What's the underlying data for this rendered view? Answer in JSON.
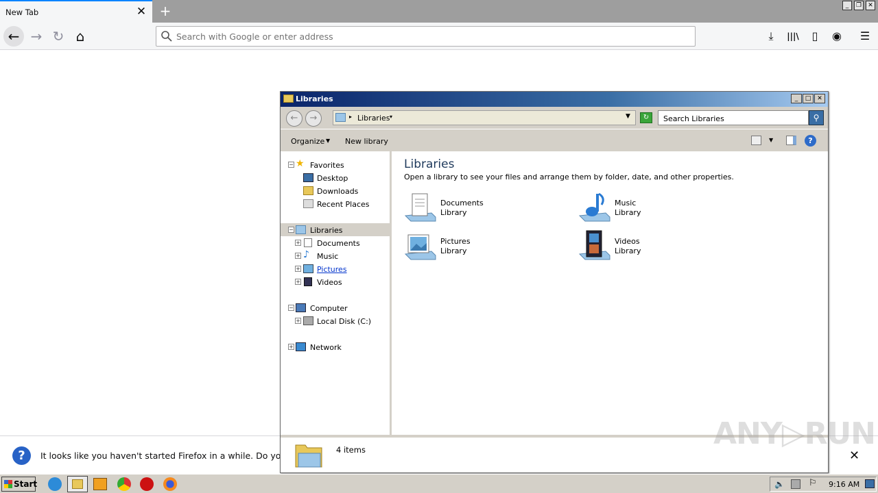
{
  "firefox": {
    "tab_title": "New Tab",
    "tab_close": "✕",
    "new_tab": "+",
    "win_buttons": [
      "_",
      "❐",
      "✕"
    ],
    "nav": {
      "back": "←",
      "forward": "→",
      "reload": "↻",
      "home": "⌂"
    },
    "url_placeholder": "Search with Google or enter address",
    "toolbar": {
      "download": "⤓",
      "library": "|||\\",
      "sidebar": "▯",
      "account": "◉",
      "menu": "☰"
    },
    "notification": "It looks like you haven't started Firefox in a while. Do you wa",
    "notification_close": "✕"
  },
  "explorer": {
    "title": "Libraries",
    "controls": [
      "_",
      "□",
      "✕"
    ],
    "address": "Libraries",
    "search_placeholder": "Search Libraries",
    "commands": {
      "organize": "Organize",
      "new_library": "New library"
    },
    "nav": {
      "favorites": "Favorites",
      "desktop": "Desktop",
      "downloads": "Downloads",
      "recent": "Recent Places",
      "libraries": "Libraries",
      "documents": "Documents",
      "music": "Music",
      "pictures": "Pictures",
      "videos": "Videos",
      "computer": "Computer",
      "local_disk": "Local Disk (C:)",
      "network": "Network"
    },
    "content": {
      "heading": "Libraries",
      "subheading": "Open a library to see your files and arrange them by folder, date, and other properties.",
      "libraries": [
        {
          "name": "Documents",
          "type": "Library"
        },
        {
          "name": "Music",
          "type": "Library"
        },
        {
          "name": "Pictures",
          "type": "Library"
        },
        {
          "name": "Videos",
          "type": "Library"
        }
      ]
    },
    "status_count": "4 items"
  },
  "taskbar": {
    "start": "Start",
    "clock": "9:16 AM"
  },
  "watermark": "ANY▷RUN",
  "colors": {
    "accent": "#0a84ff",
    "title_bar": "#0a246a",
    "nav_selected": "#d4d0c8"
  }
}
